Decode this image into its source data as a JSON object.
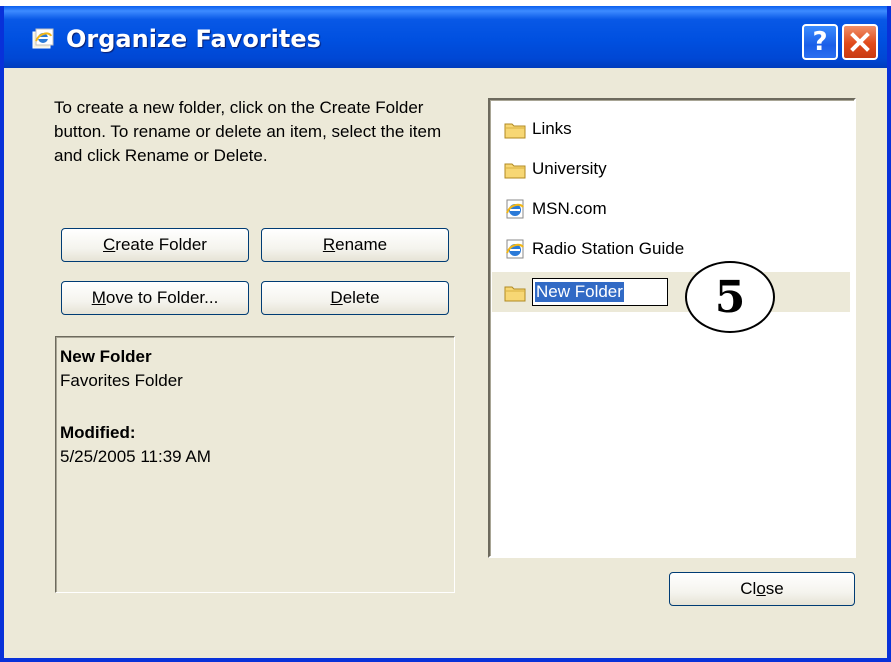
{
  "window": {
    "title": "Organize Favorites",
    "help_glyph": "?",
    "accent_color": "#0050e0",
    "close_color": "#e04a1a"
  },
  "instructions": "To create a new folder, click on the Create Folder button. To rename or delete an item, select the item and click Rename or Delete.",
  "buttons": {
    "create_folder": {
      "mnemonic": "C",
      "rest": "reate Folder"
    },
    "rename": {
      "mnemonic": "R",
      "rest": "ename"
    },
    "move_to_folder": {
      "mnemonic": "M",
      "rest": "ove to Folder..."
    },
    "delete": {
      "mnemonic": "D",
      "rest": "elete"
    },
    "close": {
      "before": "Cl",
      "mnemonic": "o",
      "rest": "se"
    }
  },
  "info": {
    "name": "New Folder",
    "type": "Favorites Folder",
    "modified_label": "Modified:",
    "modified_value": "5/25/2005 11:39 AM"
  },
  "favorites": [
    {
      "label": "Links",
      "icon": "folder-icon"
    },
    {
      "label": "University",
      "icon": "folder-icon"
    },
    {
      "label": "MSN.com",
      "icon": "ie-link-icon"
    },
    {
      "label": "Radio Station Guide",
      "icon": "ie-link-icon"
    }
  ],
  "editing_item": {
    "value": "New Folder",
    "icon": "folder-icon"
  },
  "annotation": {
    "step": "5"
  }
}
